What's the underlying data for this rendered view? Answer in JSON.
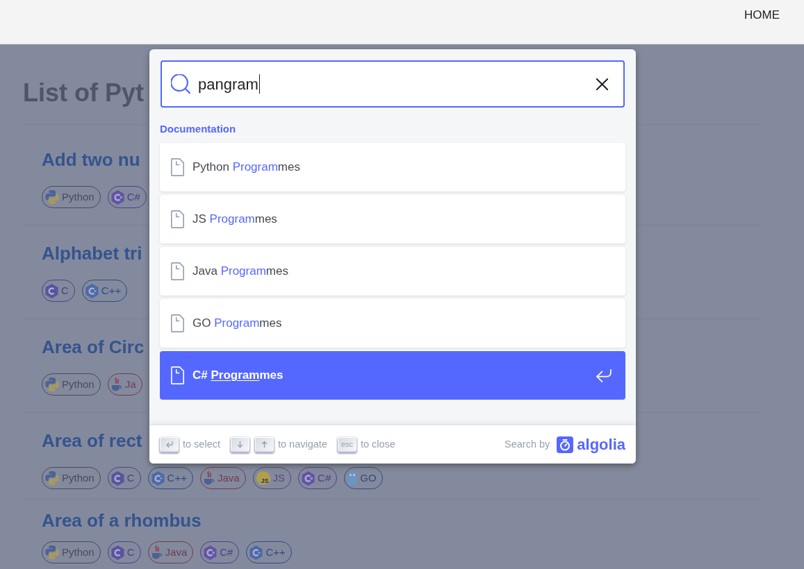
{
  "header": {
    "nav": [
      {
        "label": "HOME"
      }
    ]
  },
  "page": {
    "title": "List of Pyt",
    "items": [
      {
        "heading": "Add two nu",
        "tags": [
          {
            "kind": "python",
            "label": "Python",
            "color": "#474c5c"
          },
          {
            "kind": "csharp",
            "label": "C#",
            "color": "#4a4289"
          }
        ]
      },
      {
        "heading": "Alphabet tri",
        "tags": [
          {
            "kind": "c",
            "label": "C",
            "color": "#424787"
          },
          {
            "kind": "cpp",
            "label": "C++",
            "color": "#2f4a82"
          }
        ]
      },
      {
        "heading": "Area of Circ",
        "tags": [
          {
            "kind": "python",
            "label": "Python",
            "color": "#474c5c"
          },
          {
            "kind": "java",
            "label": "Ja",
            "color": "#733a51"
          }
        ]
      },
      {
        "heading": "Area of rect",
        "tags": [
          {
            "kind": "python",
            "label": "Python",
            "color": "#474c5c"
          },
          {
            "kind": "c",
            "label": "C",
            "color": "#424787"
          },
          {
            "kind": "cpp",
            "label": "C++",
            "color": "#2f4a82"
          },
          {
            "kind": "java",
            "label": "Java",
            "color": "#733a51"
          },
          {
            "kind": "js",
            "label": "JS",
            "icon_text": "JS",
            "color": "#564679"
          },
          {
            "kind": "csharp",
            "label": "C#",
            "color": "#4a4289"
          },
          {
            "kind": "go",
            "label": "GO",
            "color": "#2d4e80"
          }
        ]
      },
      {
        "heading": "Area of a rhombus",
        "tags": [
          {
            "kind": "python",
            "label": "Python",
            "color": "#474c5c"
          },
          {
            "kind": "c",
            "label": "C",
            "color": "#424787"
          },
          {
            "kind": "java",
            "label": "Java",
            "color": "#733a51"
          },
          {
            "kind": "csharp",
            "label": "C#",
            "color": "#4a4289"
          },
          {
            "kind": "cpp",
            "label": "C++",
            "color": "#2f4a82"
          }
        ]
      }
    ]
  },
  "search": {
    "query": "pangram",
    "source": "Documentation",
    "hits": [
      {
        "parts": [
          {
            "text": "Python ",
            "highlighted": false
          },
          {
            "text": "Program",
            "highlighted": true
          },
          {
            "text": "mes",
            "highlighted": false
          }
        ],
        "selected": false
      },
      {
        "parts": [
          {
            "text": "JS ",
            "highlighted": false
          },
          {
            "text": "Program",
            "highlighted": true
          },
          {
            "text": "mes",
            "highlighted": false
          }
        ],
        "selected": false
      },
      {
        "parts": [
          {
            "text": "Java ",
            "highlighted": false
          },
          {
            "text": "Program",
            "highlighted": true
          },
          {
            "text": "mes",
            "highlighted": false
          }
        ],
        "selected": false
      },
      {
        "parts": [
          {
            "text": "GO ",
            "highlighted": false
          },
          {
            "text": "Program",
            "highlighted": true
          },
          {
            "text": "mes",
            "highlighted": false
          }
        ],
        "selected": false
      },
      {
        "parts": [
          {
            "text": "C# ",
            "highlighted": false
          },
          {
            "text": "Program",
            "highlighted": true
          },
          {
            "text": "mes",
            "highlighted": false
          }
        ],
        "selected": true
      }
    ],
    "footer": {
      "commands": [
        {
          "keys": [
            {
              "kind": "enter"
            }
          ],
          "label": "to select"
        },
        {
          "keys": [
            {
              "kind": "down"
            },
            {
              "kind": "up"
            }
          ],
          "label": "to navigate"
        },
        {
          "keys": [
            {
              "kind": "text",
              "text": "esc"
            }
          ],
          "label": "to close"
        }
      ],
      "search_by": "Search by",
      "logo_text": "algolia"
    }
  }
}
